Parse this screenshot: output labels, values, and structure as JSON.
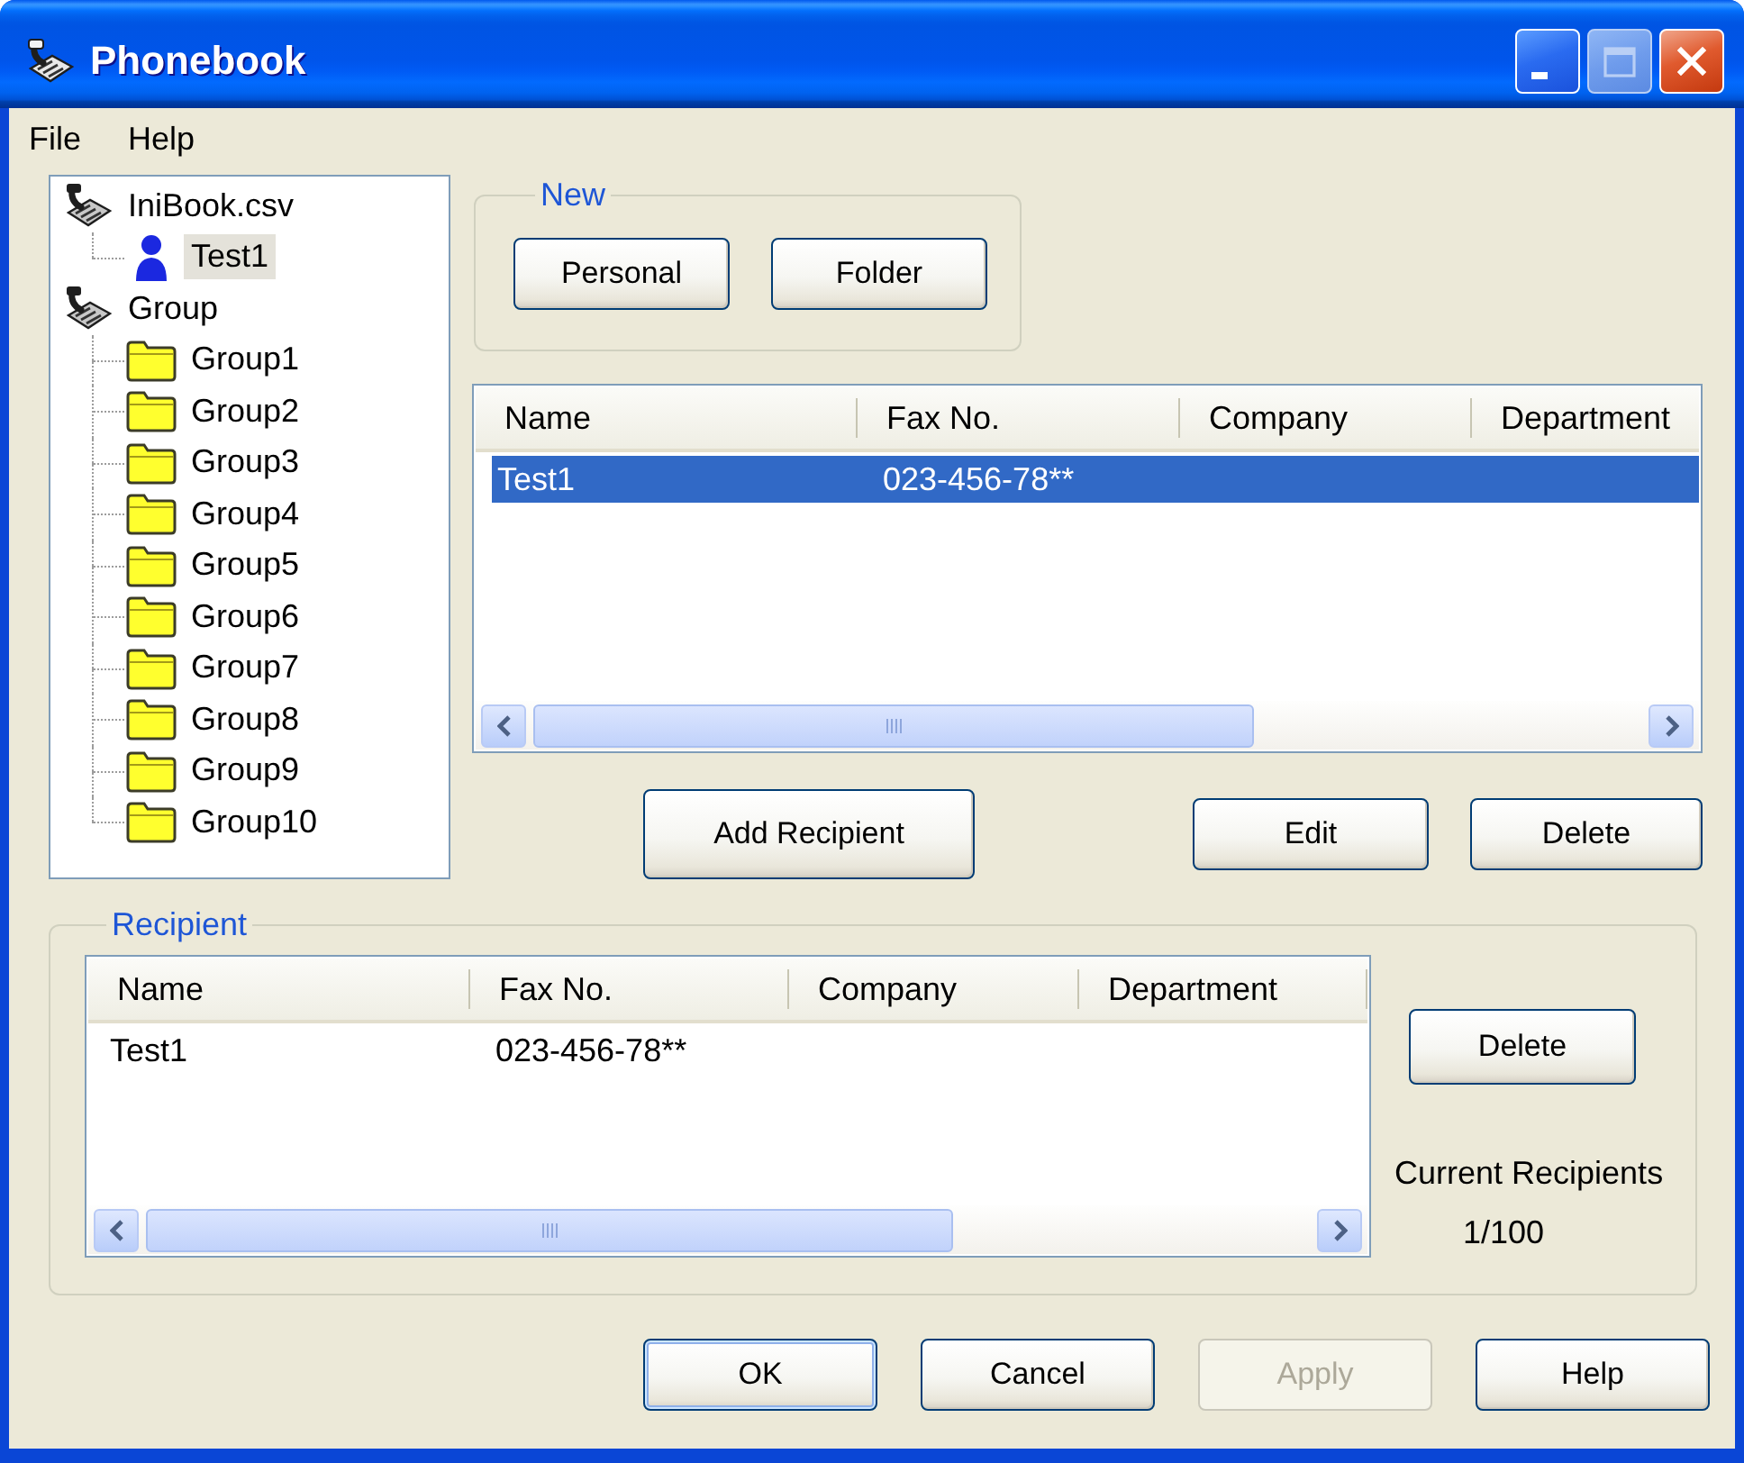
{
  "window": {
    "title": "Phonebook",
    "controls": [
      {
        "kind": "minimize",
        "disabled": false
      },
      {
        "kind": "maximize",
        "disabled": true
      },
      {
        "kind": "close",
        "disabled": false
      }
    ]
  },
  "menu": [
    {
      "label": "File"
    },
    {
      "label": "Help"
    }
  ],
  "tree": [
    {
      "label": "IniBook.csv",
      "kind": "book",
      "selected": false,
      "children": [
        {
          "label": "Test1",
          "kind": "person",
          "selected": true
        }
      ]
    },
    {
      "label": "Group",
      "kind": "book",
      "selected": false,
      "children": [
        {
          "label": "Group1",
          "kind": "folder",
          "selected": false
        },
        {
          "label": "Group2",
          "kind": "folder",
          "selected": false
        },
        {
          "label": "Group3",
          "kind": "folder",
          "selected": false
        },
        {
          "label": "Group4",
          "kind": "folder",
          "selected": false
        },
        {
          "label": "Group5",
          "kind": "folder",
          "selected": false
        },
        {
          "label": "Group6",
          "kind": "folder",
          "selected": false
        },
        {
          "label": "Group7",
          "kind": "folder",
          "selected": false
        },
        {
          "label": "Group8",
          "kind": "folder",
          "selected": false
        },
        {
          "label": "Group9",
          "kind": "folder",
          "selected": false
        },
        {
          "label": "Group10",
          "kind": "folder",
          "selected": false
        }
      ]
    }
  ],
  "new_box": {
    "title": "New",
    "buttons": [
      {
        "label": "Personal"
      },
      {
        "label": "Folder"
      }
    ]
  },
  "contact_list": {
    "columns": [
      "Name",
      "Fax No.",
      "Company",
      "Department"
    ],
    "rows": [
      {
        "cells": [
          "Test1",
          "023-456-78**"
        ],
        "selected": true
      }
    ]
  },
  "list_buttons": [
    {
      "label": "Add Recipient"
    },
    {
      "label": "Edit"
    },
    {
      "label": "Delete"
    }
  ],
  "recipient": {
    "title": "Recipient",
    "columns": [
      "Name",
      "Fax No.",
      "Company",
      "Department"
    ],
    "rows": [
      {
        "cells": [
          "Test1",
          "023-456-78**"
        ],
        "selected": false
      }
    ],
    "delete_button": {
      "label": "Delete"
    },
    "count_label": "Current Recipients",
    "count": "1/100"
  },
  "dialog_buttons": [
    {
      "label": "OK",
      "default": true,
      "disabled": false
    },
    {
      "label": "Cancel",
      "default": false,
      "disabled": false
    },
    {
      "label": "Apply",
      "default": false,
      "disabled": true
    },
    {
      "label": "Help",
      "default": false,
      "disabled": false
    }
  ]
}
